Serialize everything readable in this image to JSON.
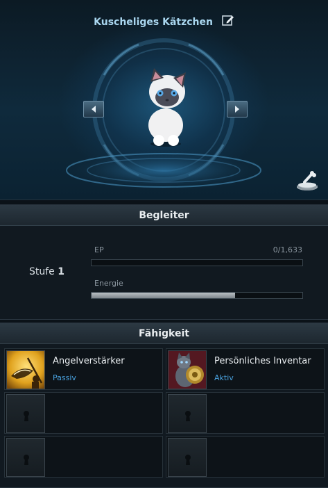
{
  "pet": {
    "name": "Kuscheliges Kätzchen",
    "icons": {
      "edit": "pencil-edit-icon",
      "prev": "arrow-left-icon",
      "next": "arrow-right-icon",
      "feed": "food-bowl-icon"
    }
  },
  "companion": {
    "header": "Begleiter",
    "level_prefix": "Stufe",
    "level_value": "1",
    "ep_label": "EP",
    "ep_value": "0/1,633",
    "ep_fraction": 0.0,
    "energy_label": "Energie",
    "energy_fraction": 0.68
  },
  "abilities": {
    "header": "Fähigkeit",
    "slots": [
      {
        "name": "Angelverstärker",
        "type": "Passiv",
        "icon": "fishing-boost-icon"
      },
      {
        "name": "Persönliches Inventar",
        "type": "Aktiv",
        "icon": "cat-backpack-icon"
      }
    ],
    "locked_icon": "keyhole-lock-icon"
  },
  "colors": {
    "accent_blue": "#4aa3e0",
    "title_blue": "#a9d6ef"
  }
}
